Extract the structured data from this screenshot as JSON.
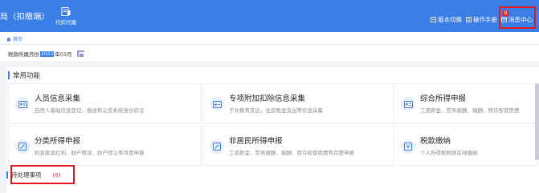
{
  "header": {
    "title_fragment": "局（扣缴端）",
    "tool": {
      "label": "代扣代缴",
      "icon": "report-icon"
    },
    "links": [
      {
        "label": "版本切换",
        "icon": "switch-icon"
      },
      {
        "label": "操作手册",
        "icon": "manual-icon"
      },
      {
        "label": "消息中心",
        "icon": "message-icon",
        "badge": "9"
      }
    ]
  },
  "breadcrumb": {
    "home_label": "首页"
  },
  "period": {
    "label": "税款所属月份",
    "year": "2023",
    "month": "年03月"
  },
  "common": {
    "title": "常用功能",
    "cards": [
      {
        "title": "人员信息采集",
        "desc": "自然人基础信息登记、报送和公安系统身份验证",
        "icon": "id-card-icon"
      },
      {
        "title": "专项附加扣除信息采集",
        "desc": "子女教育支出，住房租金支出等信息采集",
        "icon": "deduction-card-icon"
      },
      {
        "title": "综合所得申报",
        "desc": "工资薪金、劳务报酬、稿酬、特许权使用费",
        "icon": "comprehensive-tax-icon"
      },
      {
        "title": "分类所得申报",
        "desc": "利息股息红利、财产租赁、财产转让等月度申报",
        "icon": "edit-doc-icon"
      },
      {
        "title": "非居民所得申报",
        "desc": "工资薪金、劳务报酬、稿酬、特许权使用费等月度申报",
        "icon": "edit-doc-icon"
      },
      {
        "title": "税款缴纳",
        "desc": "个人所得税税款在线缴纳",
        "icon": "payment-icon"
      }
    ]
  },
  "todo": {
    "title": "待处理事项",
    "count": "(0)"
  },
  "colors": {
    "header": "#3b7ee8",
    "highlight": "#e4181c",
    "accent": "#3b7ee8"
  }
}
